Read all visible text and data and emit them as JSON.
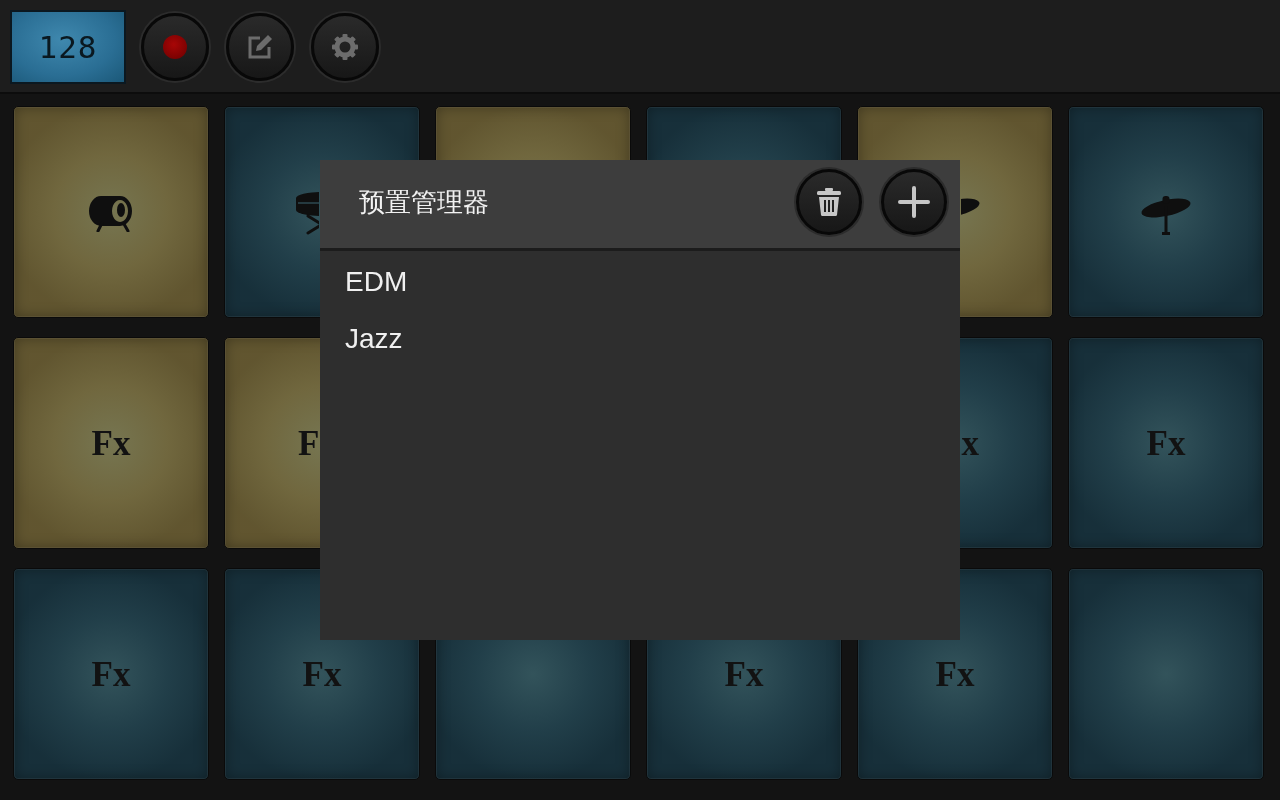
{
  "top_bar": {
    "bpm": "128"
  },
  "pad_rows": [
    {
      "pads": [
        {
          "kind": "kick",
          "color": "#6e6136"
        },
        {
          "kind": "snare",
          "color": "#1a3642"
        },
        {
          "kind": "blank",
          "color": "#6e6136"
        },
        {
          "kind": "blank",
          "color": "#1a3642"
        },
        {
          "kind": "cymbal",
          "color": "#6e6136"
        },
        {
          "kind": "cymbal",
          "color": "#1a3642"
        }
      ]
    },
    {
      "pads": [
        {
          "kind": "text",
          "color": "#6e6136",
          "label": "Fx"
        },
        {
          "kind": "text",
          "color": "#6e6136",
          "label": "F"
        },
        {
          "kind": "covered"
        },
        {
          "kind": "covered"
        },
        {
          "kind": "text",
          "color": "#1a3642",
          "label": "x"
        },
        {
          "kind": "text",
          "color": "#1a3642",
          "label": "Fx"
        }
      ]
    },
    {
      "pads": [
        {
          "kind": "text",
          "color": "#1a3642",
          "label": "Fx"
        },
        {
          "kind": "text",
          "color": "#1a3642",
          "label": "Fx"
        },
        {
          "kind": "blank",
          "color": "#1a3642"
        },
        {
          "kind": "text",
          "color": "#1a3642",
          "label": "Fx"
        },
        {
          "kind": "text",
          "color": "#1a3642",
          "label": "Fx"
        },
        {
          "kind": "blank",
          "color": "#1a3642"
        }
      ]
    }
  ],
  "dialog": {
    "title": "预置管理器",
    "items": [
      {
        "label": "EDM",
        "selected": false
      },
      {
        "label": "Jazz",
        "selected": false
      }
    ]
  }
}
